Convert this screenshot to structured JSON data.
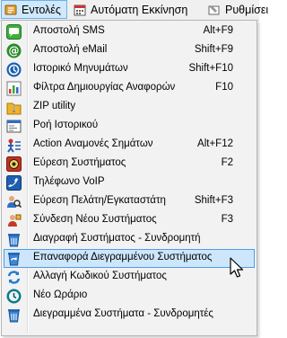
{
  "menubar": {
    "items": [
      {
        "label": "Εντολές",
        "icon": "commands-icon"
      },
      {
        "label": "Αυτόματη Εκκίνηση",
        "icon": "calendar-icon"
      },
      {
        "label": "Ρυθμίσει",
        "icon": "settings-icon"
      }
    ]
  },
  "menu": {
    "items": [
      {
        "label": "Αποστολή SMS",
        "shortcut": "Alt+F9",
        "icon": "sms-icon"
      },
      {
        "label": "Αποστολή eMail",
        "shortcut": "Shift+F9",
        "icon": "email-icon"
      },
      {
        "label": "Ιστορικό Μηνυμάτων",
        "shortcut": "Shift+F10",
        "icon": "message-history-icon"
      },
      {
        "label": "Φίλτρα Δημιουργίας Αναφορών",
        "shortcut": "F10",
        "icon": "report-filter-icon"
      },
      {
        "label": "ZIP utility",
        "shortcut": "",
        "icon": "zip-icon"
      },
      {
        "label": "Ροή Ιστορικού",
        "shortcut": "",
        "icon": "history-flow-icon"
      },
      {
        "label": "Action Αναμονές Σημάτων",
        "shortcut": "Alt+F12",
        "icon": "action-waits-icon"
      },
      {
        "label": "Εύρεση Συστήματος",
        "shortcut": "F2",
        "icon": "find-system-icon"
      },
      {
        "label": "Τηλέφωνο VoIP",
        "shortcut": "",
        "icon": "voip-phone-icon"
      },
      {
        "label": "Εύρεση Πελάτη/Εγκαταστάτη",
        "shortcut": "Shift+F3",
        "icon": "find-customer-icon"
      },
      {
        "label": "Σύνδεση Νέου Συστήματος",
        "shortcut": "F3",
        "icon": "connect-system-icon"
      },
      {
        "label": "Διαγραφή Συστήματος - Συνδρομητή",
        "shortcut": "",
        "icon": "recycle-bin-icon"
      },
      {
        "label": "Επαναφορά Διεγραμμένου Συστήματος",
        "shortcut": "",
        "icon": "restore-recycle-bin-icon"
      },
      {
        "label": "Αλλαγή Κωδικού Συστήματος",
        "shortcut": "",
        "icon": "change-code-icon"
      },
      {
        "label": "Νέο Ωράριο",
        "shortcut": "",
        "icon": "new-schedule-icon"
      },
      {
        "label": "Διεγραμμένα Συστήματα - Συνδρομητές",
        "shortcut": "",
        "icon": "deleted-systems-icon"
      }
    ],
    "highlighted_index": 12
  }
}
